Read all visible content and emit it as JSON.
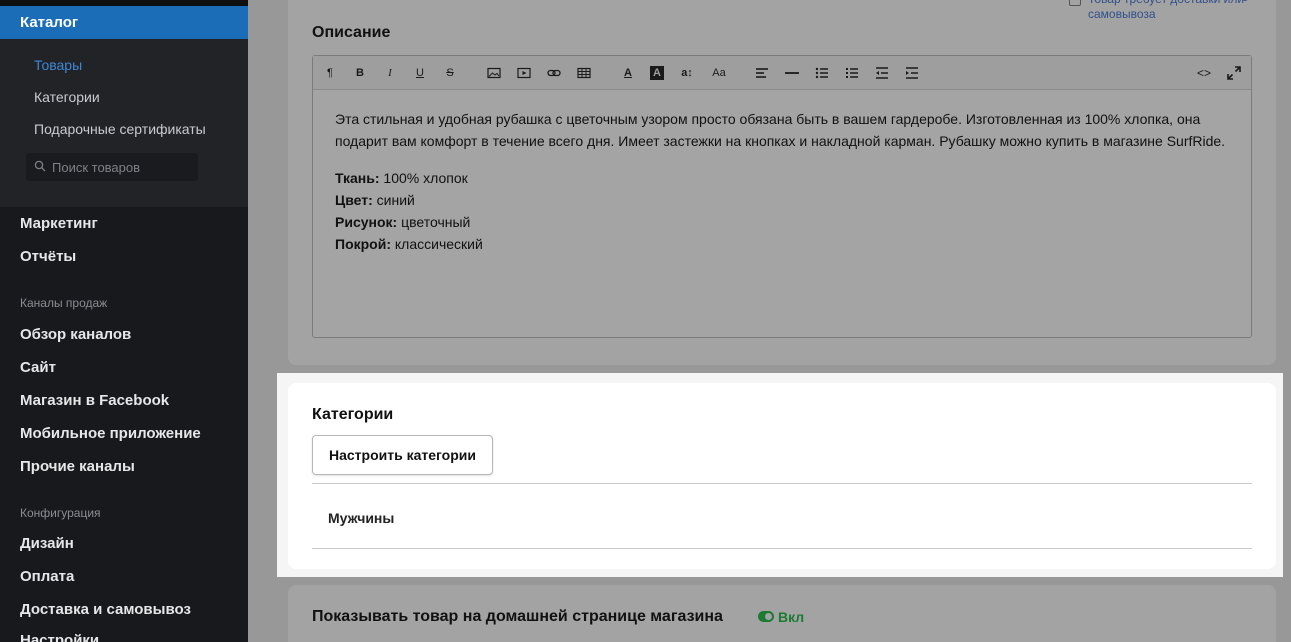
{
  "sidebar": {
    "active_section": "Каталог",
    "sub_items": [
      "Товары",
      "Категории",
      "Подарочные сертификаты"
    ],
    "search_placeholder": "Поиск товаров",
    "items_main": [
      "Маркетинг",
      "Отчёты"
    ],
    "group_channels": "Каналы продаж",
    "items_channels": [
      "Обзор каналов",
      "Сайт",
      "Магазин в Facebook",
      "Мобильное приложение",
      "Прочие каналы"
    ],
    "group_config": "Конфигурация",
    "items_config": [
      "Дизайн",
      "Оплата",
      "Доставка и самовывоз",
      "Настройки"
    ]
  },
  "description": {
    "delivery_checkbox_label": "Товар требует доставки или самовывоза",
    "title": "Описание",
    "toolbar_icons": [
      "paragraph-icon",
      "bold-icon",
      "italic-icon",
      "underline-icon",
      "strikethrough-icon",
      "image-icon",
      "video-icon",
      "link-icon",
      "table-icon",
      "font-color-icon",
      "highlight-icon",
      "line-height-icon",
      "font-size-icon",
      "align-icon",
      "horizontal-rule-icon",
      "bullet-list-icon",
      "numbered-list-icon",
      "outdent-icon",
      "indent-icon",
      "code-view-icon",
      "fullscreen-icon"
    ],
    "paragraph": "Эта стильная и удобная рубашка с цветочным узором просто обязана быть в вашем гардеробе. Изготовленная из 100% хлопка, она подарит вам комфорт в течение всего дня. Имеет застежки на кнопках и накладной карман. Рубашку можно купить в магазине SurfRide.",
    "attributes": [
      {
        "label": "Ткань:",
        "value": " 100% хлопок"
      },
      {
        "label": "Цвет:",
        "value": " синий"
      },
      {
        "label": "Рисунок:",
        "value": " цветочный"
      },
      {
        "label": "Покрой:",
        "value": " классический"
      }
    ]
  },
  "categories": {
    "title": "Категории",
    "configure_button": "Настроить категории",
    "items": [
      "Мужчины"
    ]
  },
  "home_page": {
    "title": "Показывать товар на домашней странице магазина",
    "state_label": "Вкл"
  },
  "colors": {
    "accent": "#1c6db8",
    "toggle_on": "#1c7a32",
    "sidebar_bg": "#18191c"
  }
}
